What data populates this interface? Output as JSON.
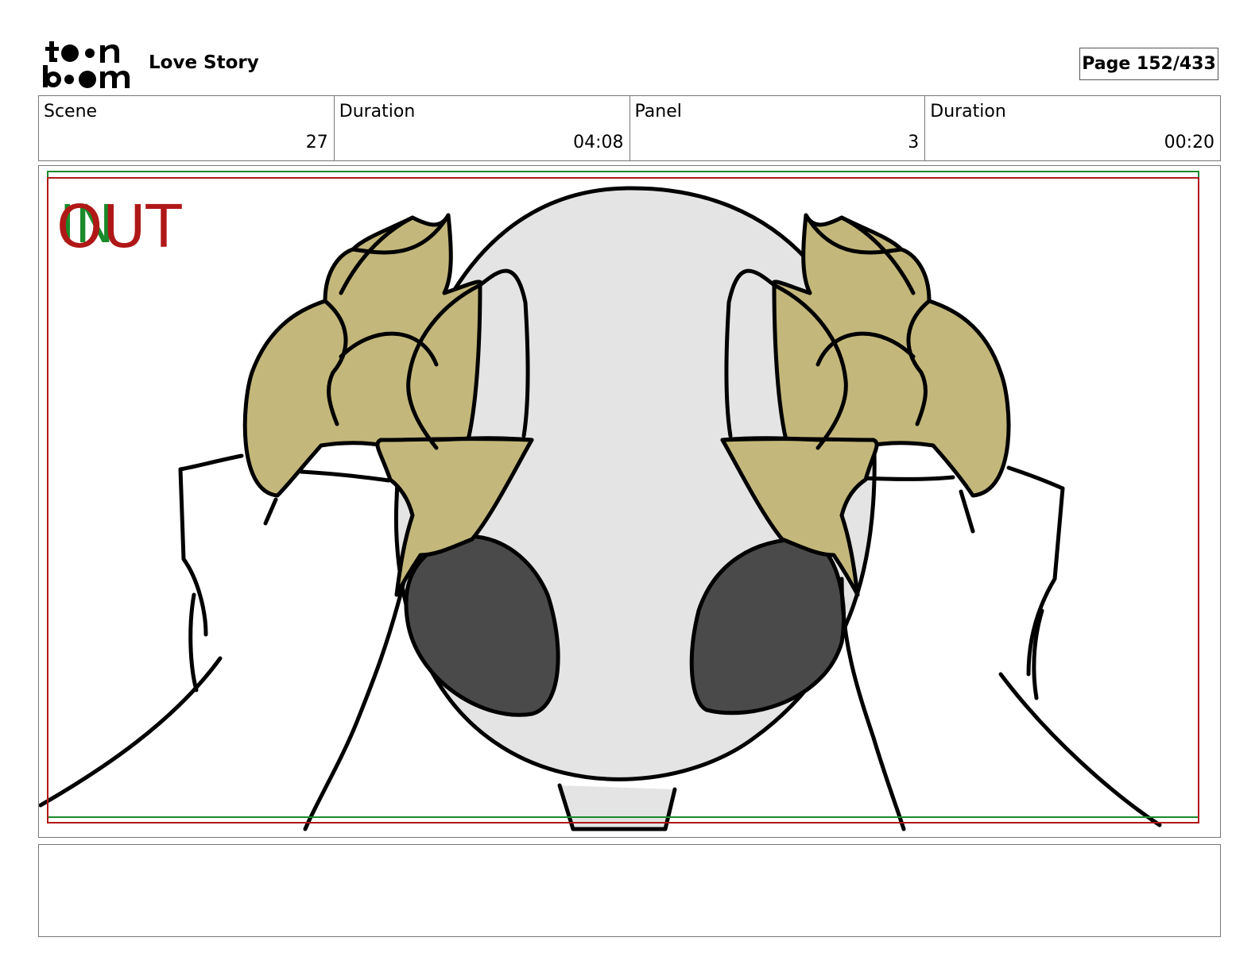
{
  "header": {
    "logo_line1": "toon",
    "logo_line2": "boom",
    "project_title": "Love Story",
    "page_label": "Page 152/433"
  },
  "info": {
    "scene_label": "Scene",
    "scene_value": "27",
    "scene_duration_label": "Duration",
    "scene_duration_value": "04:08",
    "panel_label": "Panel",
    "panel_value": "3",
    "panel_duration_label": "Duration",
    "panel_duration_value": "00:20"
  },
  "panel": {
    "in_label": "IN",
    "out_label": "OUT",
    "colors": {
      "in_frame": "#1a8a2a",
      "out_frame": "#b01818",
      "hair": "#c3b77b",
      "face": "#e4e4e4",
      "eyes": "#4a4a4a"
    }
  },
  "notes": {
    "text": ""
  }
}
